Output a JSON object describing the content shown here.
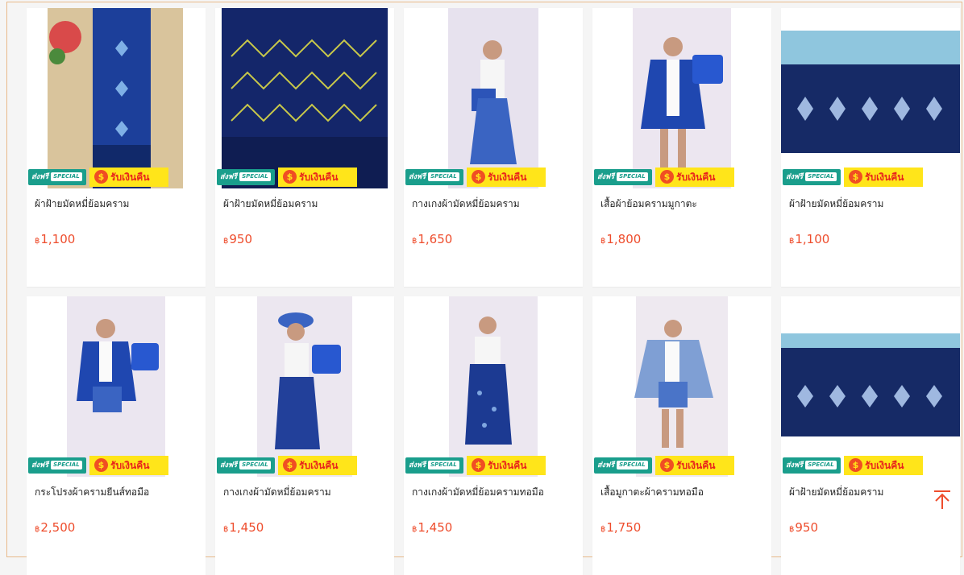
{
  "badges": {
    "shipping_main": "ส่งฟรี",
    "shipping_special": "SPECIAL",
    "cashback": "รับเงินคืน",
    "cashback_coin": "$"
  },
  "currency": "฿",
  "products": [
    {
      "name": "ผ้าฝ้ายมัดหมี่ย้อมคราม",
      "price": "1,100"
    },
    {
      "name": "ผ้าฝ้ายมัดหมี่ย้อมคราม",
      "price": "950"
    },
    {
      "name": "กางเกงผ้ามัดหมี่ย้อมคราม",
      "price": "1,650"
    },
    {
      "name": "เสื้อผ้าย้อมครามมูกาตะ",
      "price": "1,800"
    },
    {
      "name": "ผ้าฝ้ายมัดหมี่ย้อมคราม",
      "price": "1,100"
    },
    {
      "name": "กระโปรงผ้าครามยีนส์ทอมือ",
      "price": "2,500"
    },
    {
      "name": "กางเกงผ้ามัดหมี่ย้อมคราม",
      "price": "1,450"
    },
    {
      "name": "กางเกงผ้ามัดหมี่ย้อมครามทอมือ",
      "price": "1,450"
    },
    {
      "name": "เสื้อมูกาตะผ้าครามทอมือ",
      "price": "1,750"
    },
    {
      "name": "ผ้าฝ้ายมัดหมี่ย้อมคราม",
      "price": "950"
    }
  ],
  "back_to_top_icon": "arrow-up-to-line-icon",
  "colors": {
    "accent": "#ee4d2d",
    "indigo": "#1f3f8f",
    "ship_badge": "#1a9e8c",
    "cash_badge": "#ffe51a"
  }
}
